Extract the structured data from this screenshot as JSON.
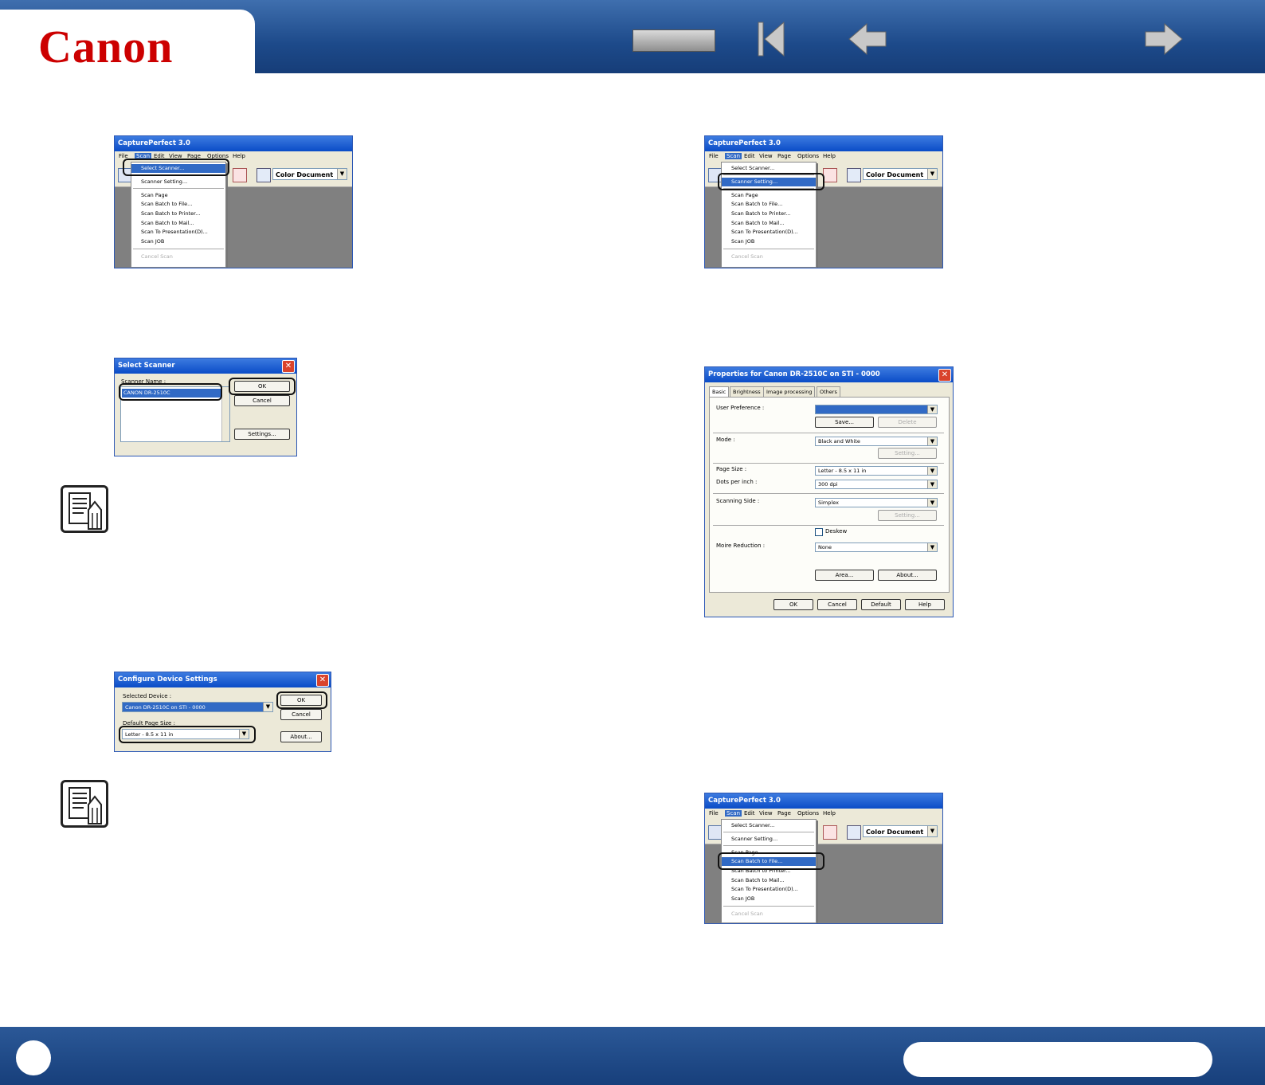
{
  "header": {
    "logo_text": "Canon"
  },
  "capture_window": {
    "title": "CapturePerfect 3.0",
    "menu": [
      "File",
      "Scan",
      "Edit",
      "View",
      "Page",
      "Options",
      "Help"
    ],
    "scan_menu_items": [
      "Select Scanner...",
      "Scanner Setting...",
      "Scan Page",
      "Scan Batch to File...",
      "Scan Batch to Printer...",
      "Scan Batch to Mail...",
      "Scan To Presentation(D)...",
      "Scan JOB",
      "Cancel Scan"
    ],
    "combo_value": "Color Document"
  },
  "select_scanner": {
    "title": "Select Scanner",
    "list_label": "Scanner Name :",
    "selected_item": "CANON DR-2510C",
    "ok": "OK",
    "cancel": "Cancel",
    "settings": "Settings..."
  },
  "configure": {
    "title": "Configure Device Settings",
    "selected_device_label": "Selected Device :",
    "selected_device": "Canon DR-2510C on STI - 0000",
    "page_size_label": "Default Page Size :",
    "page_size": "Letter - 8.5 x 11 in",
    "ok": "OK",
    "cancel": "Cancel",
    "about": "About..."
  },
  "properties": {
    "title": "Properties for Canon DR-2510C on STI - 0000",
    "tabs": [
      "Basic",
      "Brightness",
      "Image processing",
      "Others"
    ],
    "user_pref_label": "User Preference :",
    "save": "Save...",
    "delete": "Delete",
    "mode_label": "Mode :",
    "mode_value": "Black and White",
    "setting": "Setting...",
    "page_size_label": "Page Size :",
    "page_size_value": "Letter - 8.5 x 11 in",
    "dpi_label": "Dots per inch :",
    "dpi_value": "300 dpi",
    "side_label": "Scanning Side :",
    "side_value": "Simplex",
    "deskew": "Deskew",
    "moire_label": "Moire Reduction :",
    "moire_value": "None",
    "area": "Area...",
    "about": "About...",
    "ok": "OK",
    "cancel": "Cancel",
    "default": "Default",
    "help": "Help"
  }
}
